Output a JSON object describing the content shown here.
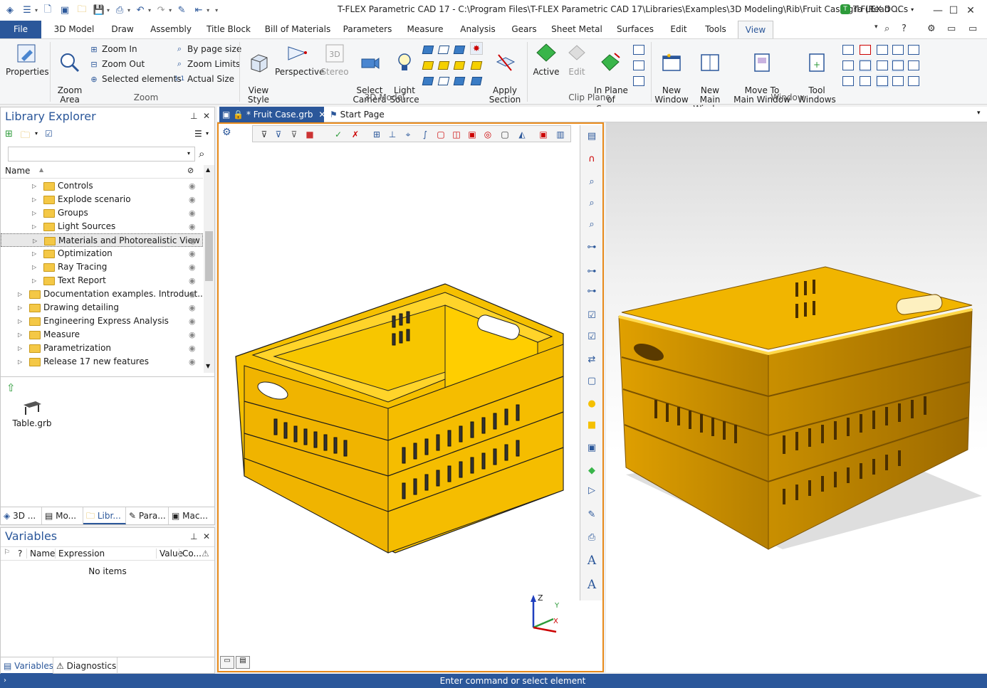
{
  "title": {
    "text": "T-FLEX Parametric CAD 17 - C:\\Program Files\\T-FLEX Parametric CAD 17\\Libraries\\Examples\\3D Modeling\\Rib\\Fruit Case.grb (Read ...",
    "docs_label": "T-FLEX DOCs"
  },
  "ribbon_tabs": [
    "File",
    "3D Model",
    "Draw",
    "Assembly",
    "Title Block",
    "Bill of Materials",
    "Parameters",
    "Measure",
    "Analysis",
    "Gears",
    "Sheet Metal",
    "Surfaces",
    "Edit",
    "Tools",
    "View"
  ],
  "ribbon": {
    "properties": "Properties",
    "zoom_area": "Zoom\nArea",
    "zoom_in": "Zoom In",
    "zoom_out": "Zoom Out",
    "selected_elements": "Selected elements",
    "by_page_size": "By page size",
    "zoom_limits": "Zoom Limits",
    "actual_size": "Actual Size",
    "group_zoom": "Zoom",
    "view_style": "View\nStyle",
    "perspective": "Perspective",
    "stereo": "Stereo",
    "select_camera": "Select\nCamera",
    "light_source": "Light\nSource",
    "apply_section": "Apply\nSection",
    "group_3d_model": "3D Model",
    "active": "Active",
    "edit": "Edit",
    "in_plane_of_screen": "In Plane\nof Screen",
    "group_clip_plane": "Clip Plane",
    "new_window": "New\nWindow",
    "new_main_window": "New Main\nWindow",
    "move_to_main_window": "Move To\nMain Window",
    "tool_windows": "Tool\nWindows",
    "group_window": "Window"
  },
  "library": {
    "title": "Library Explorer",
    "search_placeholder": "",
    "column_name": "Name",
    "tree": [
      {
        "label": "Controls",
        "level": 2
      },
      {
        "label": "Explode scenario",
        "level": 2
      },
      {
        "label": "Groups",
        "level": 2
      },
      {
        "label": "Light Sources",
        "level": 2
      },
      {
        "label": "Materials and Photorealistic View",
        "level": 2,
        "selected": true
      },
      {
        "label": "Optimization",
        "level": 2
      },
      {
        "label": "Ray Tracing",
        "level": 2
      },
      {
        "label": "Text Report",
        "level": 2
      },
      {
        "label": "Documentation examples. Introduct...",
        "level": 1
      },
      {
        "label": "Drawing detailing",
        "level": 1
      },
      {
        "label": "Engineering Express Analysis",
        "level": 1
      },
      {
        "label": "Measure",
        "level": 1
      },
      {
        "label": "Parametrization",
        "level": 1
      },
      {
        "label": "Release 17 new features",
        "level": 1
      }
    ],
    "file_name": "Table.grb",
    "bottom_tabs": [
      "3D ...",
      "Mo...",
      "Libr...",
      "Para...",
      "Mac..."
    ]
  },
  "variables": {
    "title": "Variables",
    "columns": [
      "?",
      "Name",
      "Expression",
      "Value",
      "Co..."
    ],
    "empty_text": "No items",
    "bottom_tabs": [
      "Variables",
      "Diagnostics"
    ]
  },
  "documents": {
    "active_tab": "* Fruit Case.grb",
    "start_tab": "Start Page"
  },
  "axes": {
    "z": "Z",
    "y": "Y",
    "x": "X"
  },
  "status": "Enter command or select element",
  "colors": {
    "accent": "#2b579a",
    "crate_yellow": "#f5c000",
    "crate_dark": "#a87400",
    "viewport_border": "#e88a1a"
  }
}
